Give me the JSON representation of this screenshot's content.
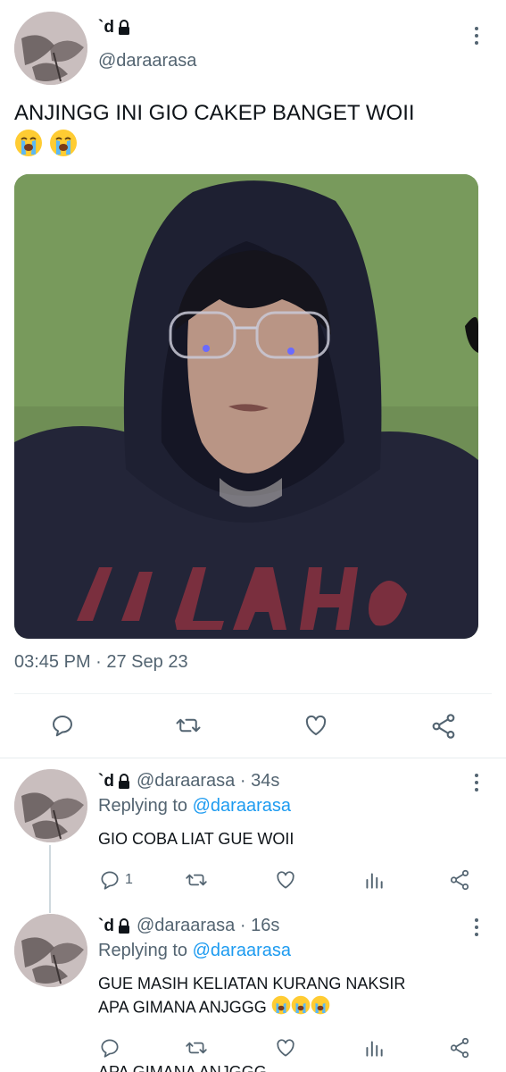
{
  "tweet": {
    "display_name": "`d",
    "handle": "@daraarasa",
    "text": "ANJINGG INI GIO CAKEP BANGET WOII",
    "emoji_count": 2,
    "timestamp": "03:45 PM · 27 Sep 23"
  },
  "replies": [
    {
      "display_name": "`d",
      "handle": "@daraarasa",
      "sep": " · ",
      "time": "34s",
      "replying_prefix": "Replying to ",
      "replying_to": "@daraarasa",
      "text": "GIO COBA LIAT GUE WOII",
      "reply_count": "1"
    },
    {
      "display_name": "`d",
      "handle": "@daraarasa",
      "sep": " · ",
      "time": "16s",
      "replying_prefix": "Replying to ",
      "replying_to": "@daraarasa",
      "text_line1": "GUE MASIH KELIATAN KURANG NAKSIR",
      "text_line2": "APA GIMANA ANJGGG",
      "reply_count": ""
    }
  ],
  "cut_text": "APA GIMANA ANJGGG",
  "colors": {
    "secondary": "#536471",
    "link": "#1d9bf0",
    "divider": "#eff3f4"
  }
}
